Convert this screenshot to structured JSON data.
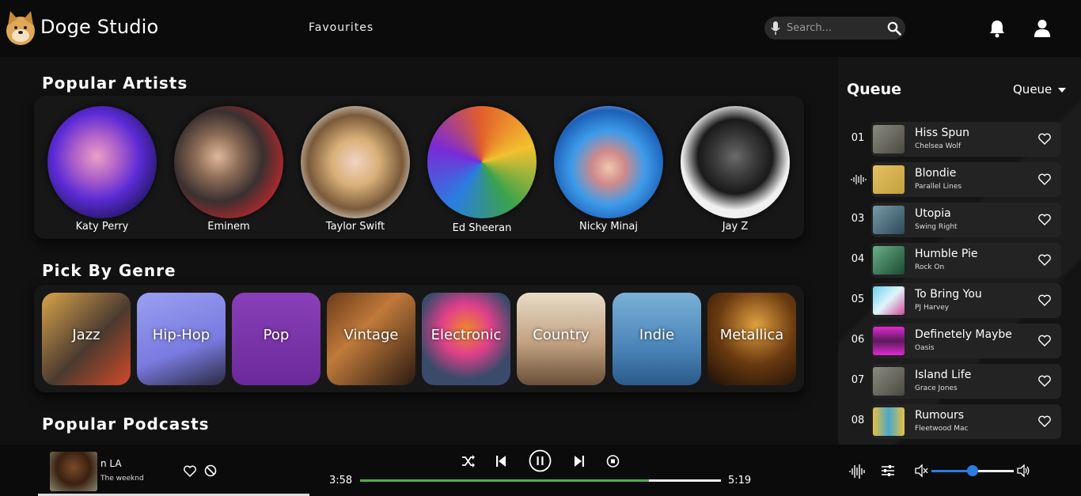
{
  "header": {
    "brand": "Doge Studio",
    "nav_favourites": "Favourites",
    "search_placeholder": "Search..."
  },
  "artists": {
    "title": "Popular Artists",
    "items": [
      {
        "name": "Katy Perry"
      },
      {
        "name": "Eminem"
      },
      {
        "name": "Taylor Swift"
      },
      {
        "name": "Ed Sheeran"
      },
      {
        "name": "Nicky Minaj"
      },
      {
        "name": "Jay Z"
      }
    ]
  },
  "genres": {
    "title": "Pick By Genre",
    "items": [
      {
        "label": "Jazz"
      },
      {
        "label": "Hip-Hop"
      },
      {
        "label": "Pop"
      },
      {
        "label": "Vintage"
      },
      {
        "label": "Electronic"
      },
      {
        "label": "Country"
      },
      {
        "label": "Indie"
      },
      {
        "label": "Metallica"
      }
    ]
  },
  "podcasts": {
    "title": "Popular Podcasts"
  },
  "queue": {
    "title": "Queue",
    "dropdown_label": "Queue",
    "items": [
      {
        "index": "01",
        "title": "Hiss Spun",
        "artist": "Chelsea Wolf"
      },
      {
        "index": "",
        "title": "Blondie",
        "artist": "Parallel Lines",
        "playing": true
      },
      {
        "index": "03",
        "title": "Utopia",
        "artist": "Swing Right"
      },
      {
        "index": "04",
        "title": "Humble Pie",
        "artist": "Rock On"
      },
      {
        "index": "05",
        "title": "To Bring You",
        "artist": "PJ Harvey"
      },
      {
        "index": "06",
        "title": "Definetely Maybe",
        "artist": "Oasis"
      },
      {
        "index": "07",
        "title": "Island Life",
        "artist": "Grace Jones"
      },
      {
        "index": "08",
        "title": "Rumours",
        "artist": "Fleetwood Mac"
      }
    ]
  },
  "player": {
    "track_title": "n LA",
    "track_artist": "The weeknd",
    "time_current": "3:58",
    "time_total": "5:19",
    "progress_fraction": 0.8,
    "volume_fraction": 0.5
  },
  "colors": {
    "accent_green": "#4caf50",
    "accent_blue": "#2a7de1"
  }
}
